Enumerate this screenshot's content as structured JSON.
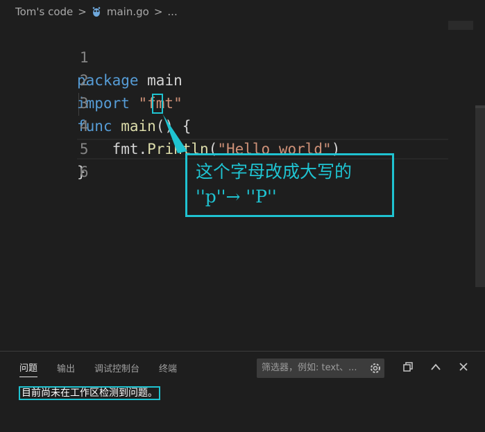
{
  "breadcrumb": {
    "folder": "Tom's code",
    "sep": ">",
    "file": "main.go",
    "rest": "..."
  },
  "editor": {
    "lines": [
      {
        "n": "1",
        "t1": "package",
        "t2": " main"
      },
      {
        "n": "2",
        "t1": "import",
        "t2": " \"fmt\""
      },
      {
        "n": "3",
        "t1": "func",
        "t2": " main",
        "t3": "() {"
      },
      {
        "n": "4",
        "t1": "    fmt.",
        "t2": "Println",
        "t3": "(",
        "t4": "\"Hello world\"",
        "t5": ")"
      },
      {
        "n": "5",
        "t1": "}"
      },
      {
        "n": "6",
        "t1": ""
      }
    ]
  },
  "annotation": {
    "line1": "这个字母改成大写的",
    "line2": "''p''→ ''P''"
  },
  "panel": {
    "tabs": [
      "问题",
      "输出",
      "调试控制台",
      "终端"
    ],
    "filter_placeholder": "筛选器，例如: text、...",
    "message": "目前尚未在工作区检测到问题。"
  },
  "icons": [
    "go-file-icon",
    "filter-settings-icon",
    "restore-panel-icon",
    "chevron-up-icon",
    "close-icon"
  ],
  "colors": {
    "accent": "#1fc3d1",
    "keyword": "#569cd6",
    "function": "#dcdcaa",
    "string": "#ce9178"
  }
}
